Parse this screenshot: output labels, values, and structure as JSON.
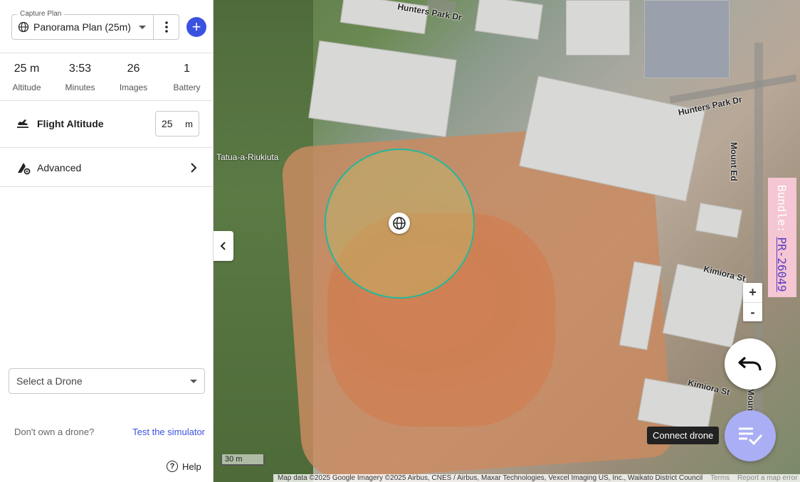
{
  "sidebar": {
    "capture_plan": {
      "legend": "Capture Plan",
      "selected": "Panorama Plan (25m)"
    },
    "stats": [
      {
        "value": "25 m",
        "label": "Altitude"
      },
      {
        "value": "3:53",
        "label": "Minutes"
      },
      {
        "value": "26",
        "label": "Images"
      },
      {
        "value": "1",
        "label": "Battery"
      }
    ],
    "flight_altitude": {
      "label": "Flight Altitude",
      "value": "25",
      "unit": "m"
    },
    "advanced": {
      "label": "Advanced"
    },
    "drone_select": {
      "placeholder": "Select a Drone"
    },
    "simulator": {
      "question": "Don't own a drone?",
      "link": "Test the simulator"
    },
    "help": {
      "label": "Help"
    }
  },
  "map": {
    "labels": {
      "hunters_park_dr_top": "Hunters Park Dr",
      "hunters_park_dr_right": "Hunters Park Dr",
      "tatua": "Tatua-a-Riukiuta",
      "mount_eden": "Mount Ed",
      "kimiora_st_top": "Kimiora St",
      "kimiora_st_bottom": "Kimiora St",
      "mount_bottom": "Mount"
    },
    "zoom_in": "+",
    "zoom_out": "-",
    "scale_label": "30 m",
    "attribution": "Map data ©2025 Google Imagery ©2025 Airbus, CNES / Airbus, Maxar Technologies, Vexcel Imaging US, Inc., Waikato District Council",
    "attribution_terms": "Terms",
    "attribution_report": "Report a map error",
    "connect_tooltip": "Connect drone",
    "bundle": {
      "prefix": "Bundle:",
      "pr": "PR-26049"
    },
    "colors": {
      "panorama_circle": "#22b89a",
      "accent": "#3b52e0",
      "fab": "#a9aef5",
      "bundle_bg": "#f5c6d3"
    }
  }
}
